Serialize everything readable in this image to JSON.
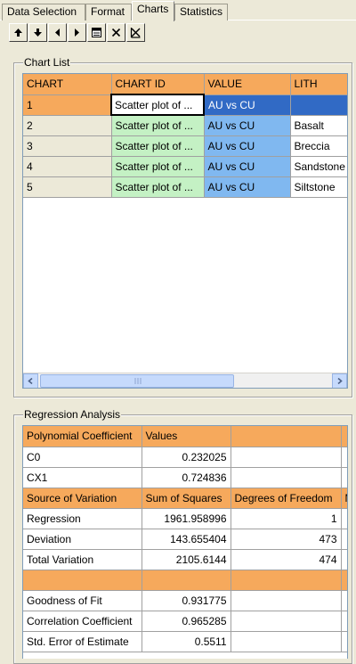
{
  "tabs": [
    {
      "label": "Data Selection"
    },
    {
      "label": "Format"
    },
    {
      "label": "Charts"
    },
    {
      "label": "Statistics"
    }
  ],
  "toolbar": {
    "icons": [
      "arrow-up-icon",
      "arrow-down-icon",
      "arrow-left-icon",
      "arrow-right-icon",
      "chart-properties-icon",
      "delete-icon",
      "delete-all-icon"
    ]
  },
  "chart_list": {
    "title": "Chart List",
    "columns": [
      "CHART",
      "CHART ID",
      "VALUE",
      "LITH"
    ],
    "rows": [
      {
        "chart": "1",
        "chart_id": "Scatter plot of ...",
        "value": "AU vs CU",
        "lith": ""
      },
      {
        "chart": "2",
        "chart_id": "Scatter plot of ...",
        "value": "AU vs CU",
        "lith": "Basalt"
      },
      {
        "chart": "3",
        "chart_id": "Scatter plot of ...",
        "value": "AU vs CU",
        "lith": "Breccia"
      },
      {
        "chart": "4",
        "chart_id": "Scatter plot of ...",
        "value": "AU vs CU",
        "lith": "Sandstone"
      },
      {
        "chart": "5",
        "chart_id": "Scatter plot of ...",
        "value": "AU vs CU",
        "lith": "Siltstone"
      }
    ]
  },
  "regression": {
    "title": "Regression Analysis",
    "coef_header": [
      "Polynomial Coefficient",
      "Values",
      ""
    ],
    "coefficients": [
      {
        "name": "C0",
        "value": "0.232025"
      },
      {
        "name": "CX1",
        "value": "0.724836"
      }
    ],
    "variation_header": [
      "Source of Variation",
      "Sum of Squares",
      "Degrees of Freedom",
      "M"
    ],
    "variation": [
      {
        "source": "Regression",
        "ss": "1961.958996",
        "df": "1"
      },
      {
        "source": "Deviation",
        "ss": "143.655404",
        "df": "473"
      },
      {
        "source": "Total Variation",
        "ss": "2105.6144",
        "df": "474"
      }
    ],
    "stats": [
      {
        "name": "Goodness of Fit",
        "value": "0.931775"
      },
      {
        "name": "Correlation Coefficient",
        "value": "0.965285"
      },
      {
        "name": "Std. Error of Estimate",
        "value": "0.5511"
      }
    ]
  }
}
